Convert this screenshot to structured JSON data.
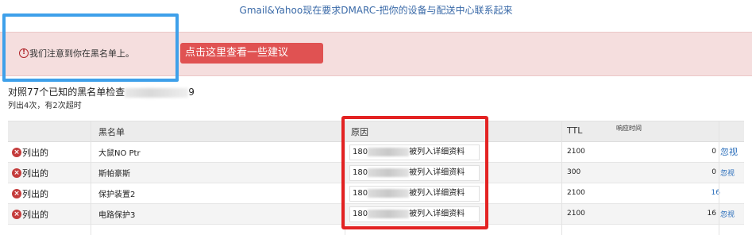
{
  "banner": {
    "link_text": "Gmail&Yahoo现在要求DMARC-把你的设备与配送中心联系起来"
  },
  "alert": {
    "icon": "alert-circle-icon",
    "message": "我们注意到你在黑名单上。",
    "button_label": "点击这里查看一些建议",
    "colors": {
      "background": "#f5dede",
      "button": "#e05252",
      "icon": "#b0262b"
    }
  },
  "summary": {
    "checked_prefix": "对照77个已知的黑名单检查",
    "checked_suffix": "9",
    "result": "列出4次，有2次超时"
  },
  "table": {
    "columns": {
      "blacklist": "黑名单",
      "reason": "原因",
      "ttl": "TTL",
      "response_time": "响应时间"
    },
    "rows": [
      {
        "status": "列出的",
        "blacklist": "大鼠NO Ptr",
        "reason_prefix": "180",
        "reason_suffix": "被列入详细资料",
        "ttl": "2100",
        "response": "0",
        "action": "忽视"
      },
      {
        "status": "列出的",
        "blacklist": "斯帕豪斯",
        "reason_prefix": "180",
        "reason_suffix": "被列入详细资料",
        "ttl": "300",
        "response": "0",
        "action": "忽视"
      },
      {
        "status": "列出的",
        "blacklist": "保护装置2",
        "reason_prefix": "180",
        "reason_suffix": "被列入详细资料",
        "ttl": "2100",
        "response": "16",
        "action": ""
      },
      {
        "status": "列出的",
        "blacklist": "电路保护3",
        "reason_prefix": "180",
        "reason_suffix": "被列入详细资料",
        "ttl": "2100",
        "response": "16",
        "action": "忽视"
      }
    ],
    "status_icon": "close-circle-icon",
    "status_color": "#c43c3c",
    "link_color": "#2a6ebb"
  },
  "highlights": {
    "blue_box_color": "#3ea0ea",
    "red_box_color": "#e32222"
  }
}
